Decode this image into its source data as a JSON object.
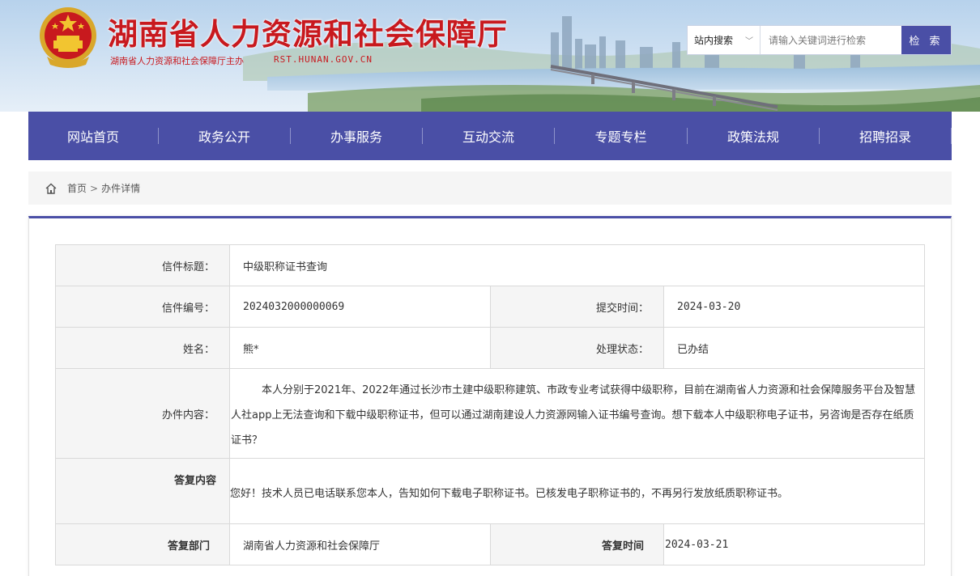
{
  "site": {
    "title": "湖南省人力资源和社会保障厅",
    "subtitle": "湖南省人力资源和社会保障厅主办",
    "url": "RST.HUNAN.GOV.CN"
  },
  "search": {
    "scope": "站内搜索",
    "placeholder": "请输入关键词进行检索",
    "button": "检 索"
  },
  "nav": {
    "items": [
      "网站首页",
      "政务公开",
      "办事服务",
      "互动交流",
      "专题专栏",
      "政策法规",
      "招聘招录"
    ]
  },
  "breadcrumb": {
    "home": "首页",
    "sep": ">",
    "current": "办件详情"
  },
  "detail": {
    "title_label": "信件标题：",
    "title_value": "中级职称证书查询",
    "number_label": "信件编号：",
    "number_value": "2024032000000069",
    "submit_label": "提交时间：",
    "submit_value": "2024-03-20",
    "name_label": "姓名：",
    "name_value": "熊*",
    "status_label": "处理状态：",
    "status_value": "已办结",
    "content_label": "办件内容：",
    "content_value": "本人分别于2021年、2022年通过长沙市土建中级职称建筑、市政专业考试获得中级职称，目前在湖南省人力资源和社会保障服务平台及智慧人社app上无法查询和下载中级职称证书，但可以通过湖南建设人力资源网输入证书编号查询。想下载本人中级职称电子证书，另咨询是否存在纸质证书？",
    "reply_label": "答复内容",
    "reply_value": "您好！技术人员已电话联系您本人，告知如何下载电子职称证书。已核发电子职称证书的，不再另行发放纸质职称证书。",
    "dept_label": "答复部门",
    "dept_value": "湖南省人力资源和社会保障厅",
    "reply_time_label": "答复时间",
    "reply_time_value": "2024-03-21"
  },
  "colors": {
    "brand_red": "#c8191e",
    "nav_blue": "#4a4fa6"
  }
}
